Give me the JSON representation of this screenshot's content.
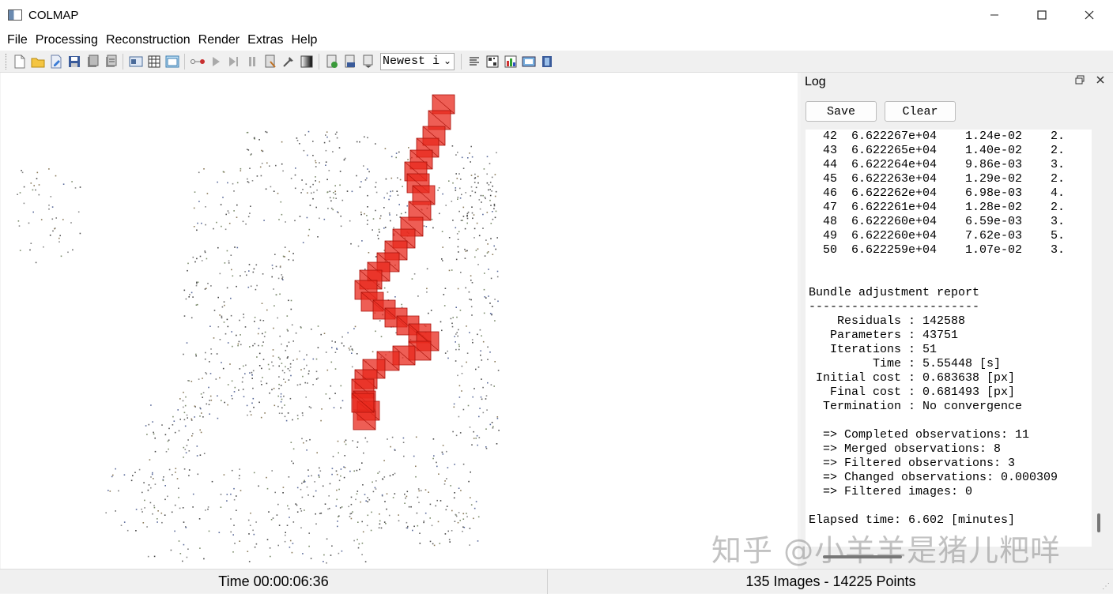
{
  "window": {
    "title": "COLMAP"
  },
  "menu": [
    "File",
    "Processing",
    "Reconstruction",
    "Render",
    "Extras",
    "Help"
  ],
  "toolbar": {
    "render_select_value": "Newest i"
  },
  "log": {
    "title": "Log",
    "save_label": "Save",
    "clear_label": "Clear",
    "iteration_rows": [
      {
        "iter": "42",
        "cost": "6.622267e+04",
        "change": "1.24e-02",
        "extra": "2."
      },
      {
        "iter": "43",
        "cost": "6.622265e+04",
        "change": "1.40e-02",
        "extra": "2."
      },
      {
        "iter": "44",
        "cost": "6.622264e+04",
        "change": "9.86e-03",
        "extra": "3."
      },
      {
        "iter": "45",
        "cost": "6.622263e+04",
        "change": "1.29e-02",
        "extra": "2."
      },
      {
        "iter": "46",
        "cost": "6.622262e+04",
        "change": "6.98e-03",
        "extra": "4."
      },
      {
        "iter": "47",
        "cost": "6.622261e+04",
        "change": "1.28e-02",
        "extra": "2."
      },
      {
        "iter": "48",
        "cost": "6.622260e+04",
        "change": "6.59e-03",
        "extra": "3."
      },
      {
        "iter": "49",
        "cost": "6.622260e+04",
        "change": "7.62e-03",
        "extra": "5."
      },
      {
        "iter": "50",
        "cost": "6.622259e+04",
        "change": "1.07e-02",
        "extra": "3."
      }
    ],
    "report_title": "Bundle adjustment report",
    "report_rule": "------------------------",
    "report": [
      {
        "key": "Residuals",
        "value": "142588"
      },
      {
        "key": "Parameters",
        "value": "43751"
      },
      {
        "key": "Iterations",
        "value": "51"
      },
      {
        "key": "Time",
        "value": "5.55448 [s]"
      },
      {
        "key": "Initial cost",
        "value": "0.683638 [px]"
      },
      {
        "key": "Final cost",
        "value": "0.681493 [px]"
      },
      {
        "key": "Termination",
        "value": "No convergence"
      }
    ],
    "observations": [
      "=> Completed observations: 11",
      "=> Merged observations: 8",
      "=> Filtered observations: 3",
      "=> Changed observations: 0.000309",
      "=> Filtered images: 0"
    ],
    "elapsed": "Elapsed time: 6.602 [minutes]"
  },
  "status": {
    "time": "Time 00:00:06:36",
    "counts": "135 Images - 14225 Points"
  },
  "watermark": "知乎 @小羊羊是猪儿粑咩",
  "colors": {
    "camera": "#e8281c",
    "points": "#555555"
  },
  "icons": [
    "new-project-icon",
    "open-project-icon",
    "edit-project-icon",
    "save-project-icon",
    "import-model-icon",
    "export-model-icon",
    "feature-extraction-icon",
    "feature-matching-icon",
    "database-icon",
    "reconstruction-start-icon",
    "reconstruction-step-icon",
    "reconstruction-pause-icon",
    "reconstruction-options-icon",
    "bundle-adjustment-icon",
    "render-options-icon",
    "undistort-icon",
    "dense-reconstruction-icon",
    "model-info-icon",
    "log-icon",
    "match-matrix-icon",
    "statistics-icon",
    "screenshot-icon",
    "movie-grabber-icon"
  ]
}
